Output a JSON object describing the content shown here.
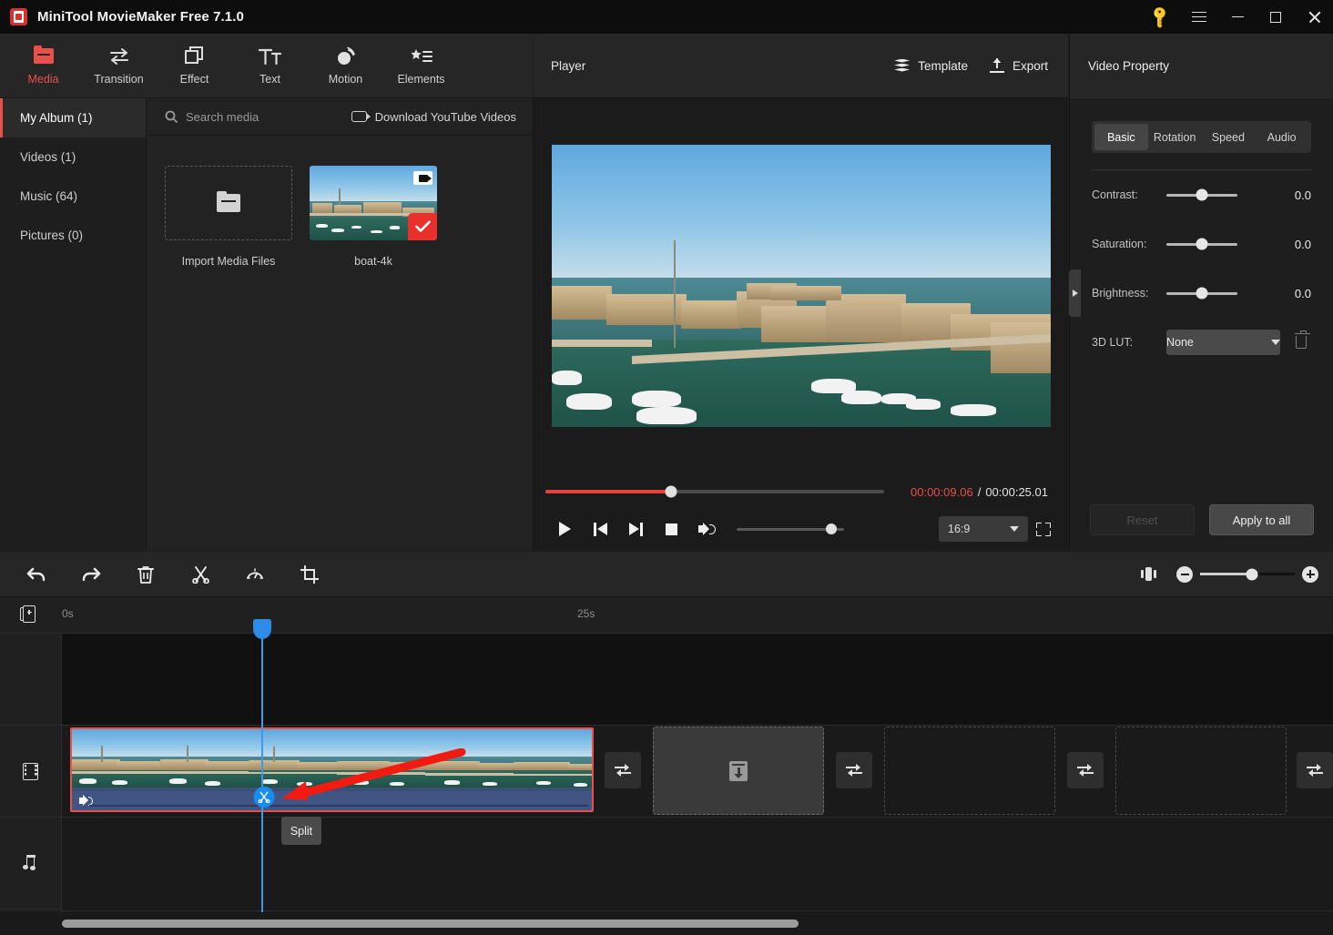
{
  "window": {
    "title": "MiniTool MovieMaker Free 7.1.0",
    "controls": {
      "key": "key-icon",
      "menu": "menu-icon",
      "minimize": "–",
      "maximize": "□",
      "close": "✕"
    }
  },
  "toolbar": {
    "items": [
      {
        "label": "Media",
        "icon": "folder-icon",
        "active": true
      },
      {
        "label": "Transition",
        "icon": "transition-arrows-icon",
        "active": false
      },
      {
        "label": "Effect",
        "icon": "layers-icon",
        "active": false
      },
      {
        "label": "Text",
        "icon": "text-icon",
        "active": false
      },
      {
        "label": "Motion",
        "icon": "motion-icon",
        "active": false
      },
      {
        "label": "Elements",
        "icon": "elements-icon",
        "active": false
      }
    ]
  },
  "sidebar": {
    "items": [
      {
        "label": "My Album (1)",
        "active": true
      },
      {
        "label": "Videos (1)",
        "active": false
      },
      {
        "label": "Music (64)",
        "active": false
      },
      {
        "label": "Pictures (0)",
        "active": false
      }
    ]
  },
  "media": {
    "search_placeholder": "Search media",
    "youtube_label": "Download YouTube Videos",
    "import_label": "Import Media Files",
    "clips": [
      {
        "name": "boat-4k",
        "selected": true,
        "type": "video"
      }
    ]
  },
  "player": {
    "title": "Player",
    "template_label": "Template",
    "export_label": "Export",
    "current_time": "00:00:09.06",
    "separator": "/",
    "total_time": "00:00:25.01",
    "progress_percent": 37,
    "volume_percent": 88,
    "aspect_ratio": "16:9",
    "buttons": [
      "play",
      "previous-frame",
      "next-frame",
      "stop",
      "volume",
      "fullscreen"
    ]
  },
  "property": {
    "title": "Video Property",
    "tabs": [
      {
        "label": "Basic",
        "active": true
      },
      {
        "label": "Rotation",
        "active": false
      },
      {
        "label": "Speed",
        "active": false
      },
      {
        "label": "Audio",
        "active": false
      }
    ],
    "rows": [
      {
        "label": "Contrast:",
        "value": "0.0",
        "knob_percent": 50
      },
      {
        "label": "Saturation:",
        "value": "0.0",
        "knob_percent": 50
      },
      {
        "label": "Brightness:",
        "value": "0.0",
        "knob_percent": 50
      }
    ],
    "lut": {
      "label": "3D LUT:",
      "value": "None"
    },
    "reset_label": "Reset",
    "apply_label": "Apply to all"
  },
  "timeline": {
    "tools": [
      "undo",
      "redo",
      "delete",
      "split",
      "speed",
      "crop"
    ],
    "zoom_percent": 55,
    "ruler": {
      "start": "0s",
      "mark": "25s"
    },
    "tracks": [
      {
        "type": "overlay",
        "icon": ""
      },
      {
        "type": "video",
        "icon": "film-icon"
      },
      {
        "type": "music",
        "icon": "music-note-icon"
      }
    ],
    "clip": {
      "name": "boat-4k",
      "selected": true,
      "muted": false
    },
    "split_tooltip": "Split",
    "placeholders": 3,
    "transition_slots": 4
  }
}
